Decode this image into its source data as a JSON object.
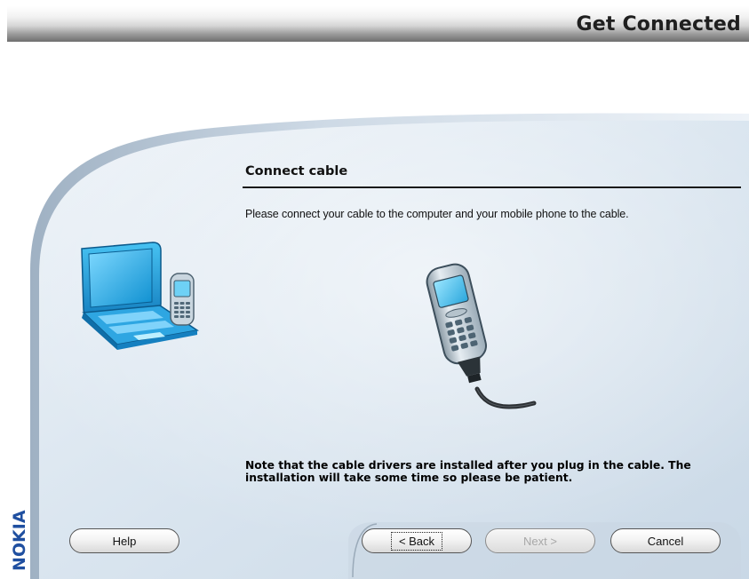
{
  "header": {
    "title": "Get Connected"
  },
  "brand": {
    "logo_text": "NOKIA"
  },
  "content": {
    "section_title": "Connect cable",
    "instruction": "Please connect your cable to the computer and your mobile phone to the cable.",
    "note": "Note that the cable drivers are installed after you plug in the cable. The installation will take some time so please be patient."
  },
  "buttons": {
    "help": "Help",
    "back": "< Back",
    "next": "Next >",
    "cancel": "Cancel"
  },
  "icons": {
    "laptop_phone": "laptop-phone-icon",
    "phone_cable": "phone-cable-icon"
  },
  "colors": {
    "panel_light": "#dce7f1",
    "panel_dark": "#a9bed4",
    "accent_cyan": "#22a9e0",
    "text": "#111111",
    "disabled": "#a8a8a8"
  }
}
